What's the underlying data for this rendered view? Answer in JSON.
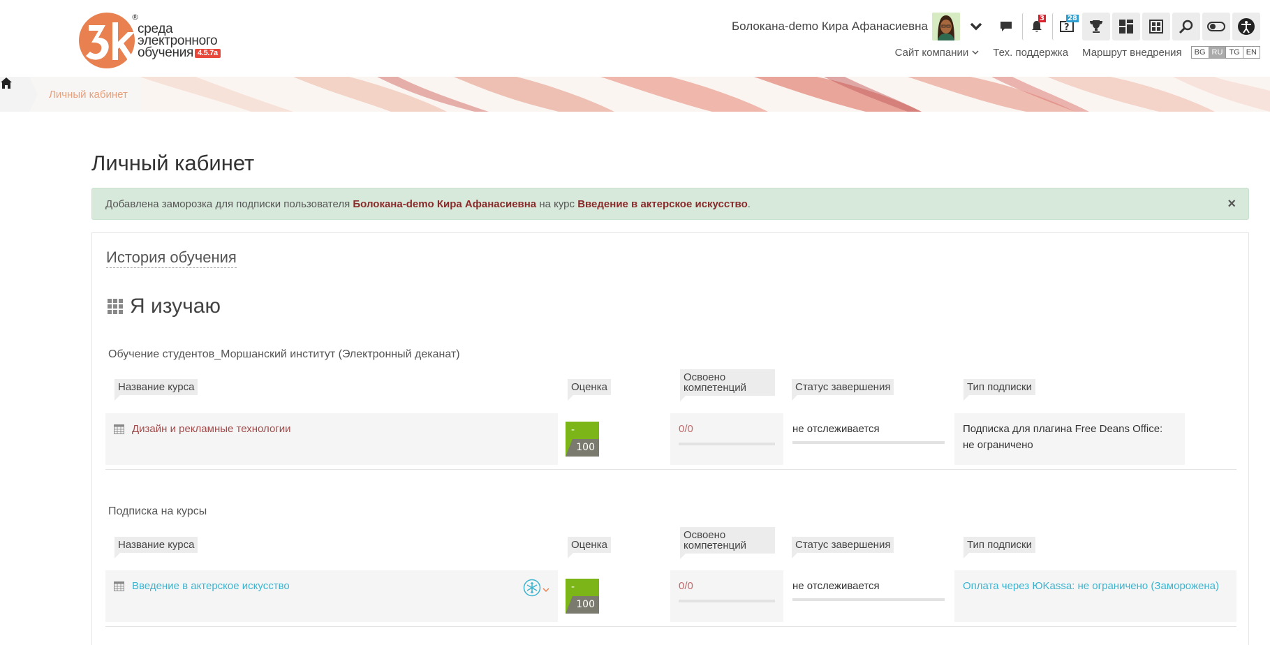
{
  "logo": {
    "line1": "среда",
    "line2": "электронного",
    "line3": "обучения",
    "version": "4.5.7a",
    "reg": "®",
    "brand_color": "#e8804f"
  },
  "header": {
    "user_name": "Болокана-demo Кира Афанасиевна",
    "notifications_count": "3",
    "help_count": "28",
    "nav": {
      "company_site": "Сайт компании",
      "support": "Тех. поддержка",
      "route": "Маршрут внедрения"
    },
    "languages": [
      {
        "code": "BG",
        "active": false
      },
      {
        "code": "RU",
        "active": true
      },
      {
        "code": "TG",
        "active": false
      },
      {
        "code": "EN",
        "active": false
      }
    ]
  },
  "breadcrumb": {
    "current": "Личный кабинет"
  },
  "page": {
    "title": "Личный кабинет"
  },
  "alert": {
    "prefix": "Добавлена заморозка для подписки пользователя ",
    "user": "Болокана-demo Кира Афанасиевна",
    "middle": " на курс ",
    "course": "Введение в актерское искусство",
    "suffix": ".",
    "close": "×"
  },
  "panel": {
    "history_link": "История обучения",
    "section_title": "Я изучаю",
    "columns": {
      "name": "Название курса",
      "grade": "Оценка",
      "competencies_line1": "Освоено",
      "competencies_line2": "компетенций",
      "status": "Статус завершения",
      "subscription": "Тип подписки"
    },
    "groups": [
      {
        "title": "Обучение студентов_Моршанский институт (Электронный деканат)",
        "course": "Дизайн и рекламные технологии",
        "grade_value": "-",
        "grade_max": "100",
        "competencies": "0/0",
        "status": "не отслеживается",
        "subscription_line1": "Подписка для плагина Free Deans Office:",
        "subscription_line2": "не ограничено"
      },
      {
        "title": "Подписка на курсы",
        "course": "Введение в актерское искусство",
        "grade_value": "-",
        "grade_max": "100",
        "competencies": "0/0",
        "status": "не отслеживается",
        "subscription_line1": "Оплата через ЮKassa: не ограничено (Заморожена)",
        "subscription_line2": ""
      }
    ]
  }
}
